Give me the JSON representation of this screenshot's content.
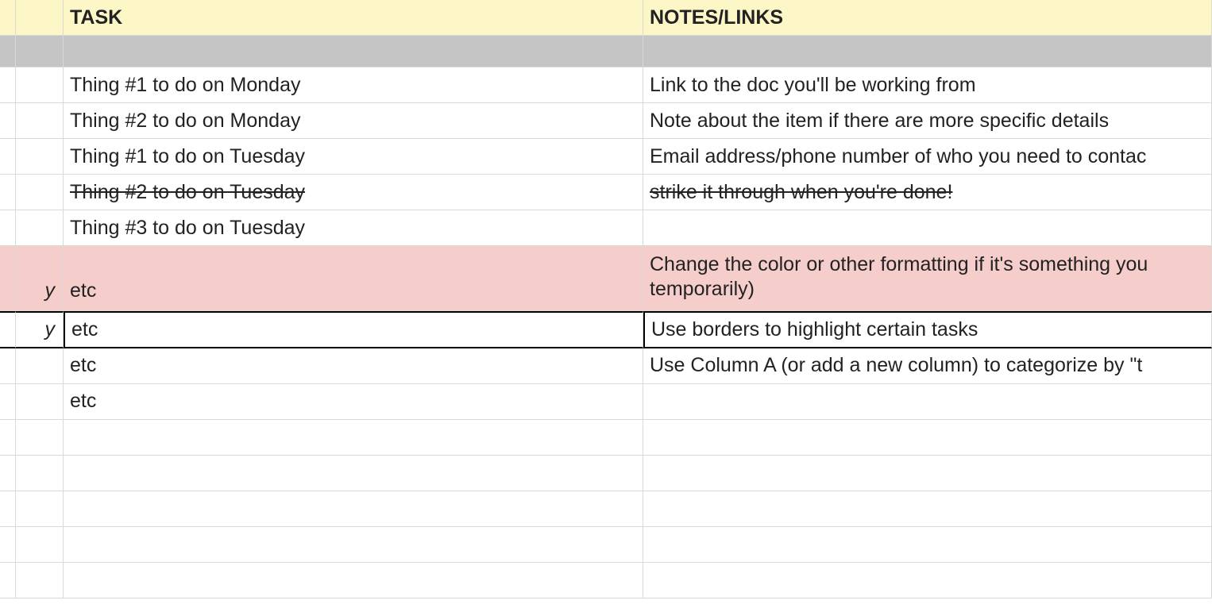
{
  "columns": {
    "task": "TASK",
    "notes": "NOTES/LINKS"
  },
  "rows": [
    {
      "a": "",
      "task": "",
      "notes": "",
      "style": "gray"
    },
    {
      "a": "",
      "task": "Thing #1 to do on Monday",
      "notes": "Link to the doc you'll be working from"
    },
    {
      "a": "",
      "task": "Thing #2 to do on Monday",
      "notes": "Note about the item if there are more specific details"
    },
    {
      "a": "",
      "task": "Thing #1 to do on Tuesday",
      "notes": "Email address/phone number of who you need to contac"
    },
    {
      "a": "",
      "task": "Thing #2 to do on Tuesday",
      "notes": "strike it through when you're done!",
      "strike": true
    },
    {
      "a": "",
      "task": "Thing #3 to do on Tuesday",
      "notes": ""
    },
    {
      "a": "y",
      "task": "etc",
      "notes": "Change the color or other formatting if it's something you temporarily)",
      "style": "pink"
    },
    {
      "a": "y",
      "task": "etc",
      "notes": "Use borders to highlight certain tasks",
      "style": "bordered"
    },
    {
      "a": "",
      "task": "etc",
      "notes": "Use Column A (or add a new column) to categorize by \"t"
    },
    {
      "a": "",
      "task": "etc",
      "notes": ""
    },
    {
      "a": "",
      "task": "",
      "notes": ""
    },
    {
      "a": "",
      "task": "",
      "notes": ""
    },
    {
      "a": "",
      "task": "",
      "notes": ""
    },
    {
      "a": "",
      "task": "",
      "notes": ""
    },
    {
      "a": "",
      "task": "",
      "notes": ""
    }
  ]
}
